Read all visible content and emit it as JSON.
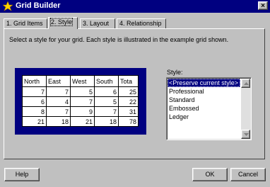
{
  "window": {
    "title": "Grid Builder",
    "close_label": "×"
  },
  "tabs": [
    {
      "label": "1. Grid Items"
    },
    {
      "label": "2. Style"
    },
    {
      "label": "3. Layout"
    },
    {
      "label": "4. Relationship"
    }
  ],
  "instruction": "Select a style for your grid. Each style is illustrated in the example grid shown.",
  "preview_grid": {
    "headers": [
      "North",
      "East",
      "West",
      "South",
      "Tota"
    ],
    "rows": [
      [
        "7",
        "7",
        "5",
        "6",
        "25"
      ],
      [
        "6",
        "4",
        "7",
        "5",
        "22"
      ],
      [
        "8",
        "7",
        "9",
        "7",
        "31"
      ],
      [
        "21",
        "18",
        "21",
        "18",
        "78"
      ]
    ]
  },
  "style_panel": {
    "label": "Style:",
    "options": [
      "<Preserve current style>",
      "Professional",
      "Standard",
      "Embossed",
      "Ledger"
    ],
    "selected": "<Preserve current style>"
  },
  "buttons": {
    "help": "Help",
    "ok": "OK",
    "cancel": "Cancel"
  },
  "colors": {
    "titlebar": "#000080",
    "dialog": "#c0c0c0",
    "preview_bg": "#000080",
    "selection": "#000080"
  }
}
